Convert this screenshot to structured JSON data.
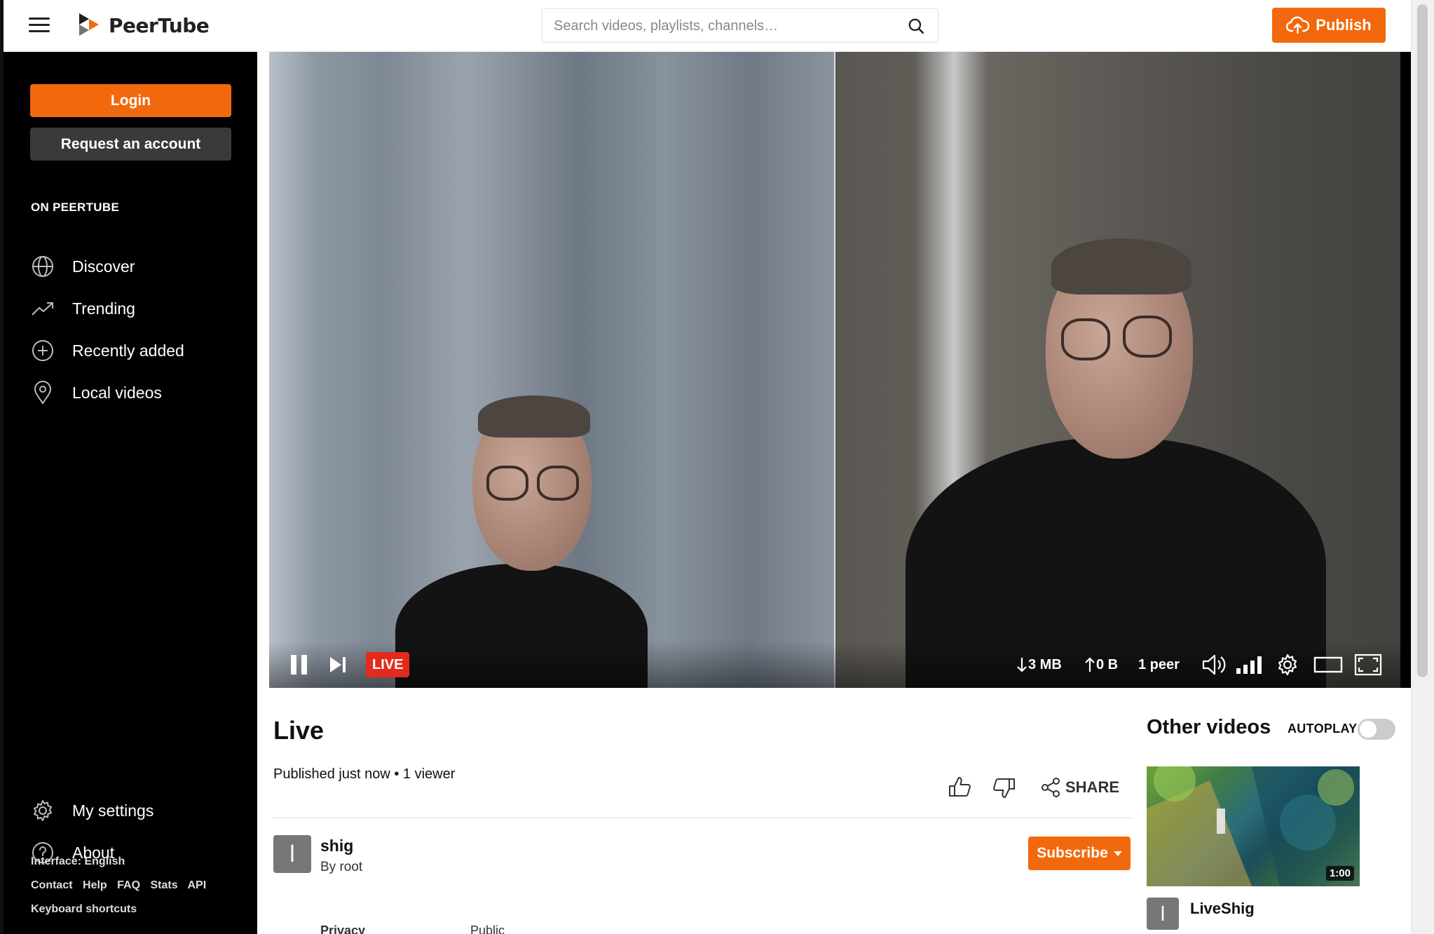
{
  "header": {
    "brand": "PeerTube",
    "search_placeholder": "Search videos, playlists, channels…",
    "publish_label": "Publish",
    "brand_color": "#f2690d"
  },
  "sidebar": {
    "login_label": "Login",
    "request_label": "Request an account",
    "section_title": "ON PEERTUBE",
    "items": [
      {
        "label": "Discover",
        "icon": "globe-icon"
      },
      {
        "label": "Trending",
        "icon": "trending-icon"
      },
      {
        "label": "Recently added",
        "icon": "plus-circle-icon"
      },
      {
        "label": "Local videos",
        "icon": "map-pin-icon"
      }
    ],
    "bottom_items": [
      {
        "label": "My settings",
        "icon": "gear-icon"
      },
      {
        "label": "About",
        "icon": "help-circle-icon"
      }
    ],
    "interface_label": "Interface: English",
    "footer_links": [
      "Contact",
      "Help",
      "FAQ",
      "Stats",
      "API"
    ],
    "keyboard_shortcuts": "Keyboard shortcuts"
  },
  "player": {
    "live_label": "LIVE",
    "download": "3 MB",
    "upload": "0 B",
    "peers": "1 peer",
    "live_color": "#e42a1c"
  },
  "video": {
    "title": "Live",
    "meta": "Published just now • 1 viewer",
    "share_label": "SHARE",
    "channel_initial": "l",
    "channel_name": "shig",
    "channel_by": "By root",
    "subscribe_label": "Subscribe",
    "privacy_label": "Privacy",
    "privacy_value": "Public"
  },
  "related": {
    "title": "Other videos",
    "autoplay_label": "AUTOPLAY",
    "autoplay_on": false,
    "items": [
      {
        "duration": "1:00",
        "channel_initial": "l",
        "name": "LiveShig"
      }
    ]
  }
}
